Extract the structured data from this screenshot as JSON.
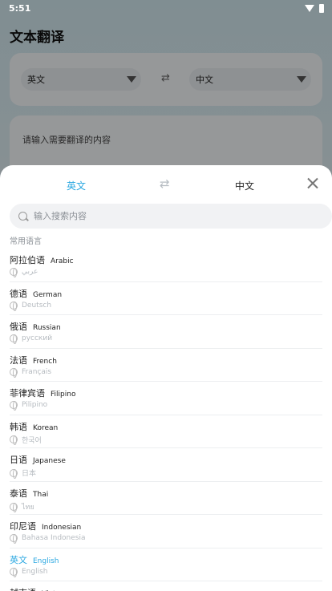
{
  "status_bar": {
    "time": "5:51"
  },
  "background_page": {
    "title": "文本翻译",
    "source_lang": "英文",
    "target_lang": "中文",
    "swap_glyph": "⇄",
    "input_placeholder": "请输入需要翻译的内容"
  },
  "sheet": {
    "source_tab": "英文",
    "swap_glyph": "⇄",
    "target_tab": "中文",
    "search_placeholder": "输入搜索内容",
    "section_label": "常用语言",
    "accent_color": "#29a7e1",
    "languages": [
      {
        "zh": "阿拉伯语",
        "en": "Arabic",
        "native": "عربي"
      },
      {
        "zh": "德语",
        "en": "German",
        "native": "Deutsch"
      },
      {
        "zh": "俄语",
        "en": "Russian",
        "native": "русский"
      },
      {
        "zh": "法语",
        "en": "French",
        "native": "Français"
      },
      {
        "zh": "菲律宾语",
        "en": "Filipino",
        "native": "Pilipino"
      },
      {
        "zh": "韩语",
        "en": "Korean",
        "native": "한국어"
      },
      {
        "zh": "日语",
        "en": "Japanese",
        "native": "日本"
      },
      {
        "zh": "泰语",
        "en": "Thai",
        "native": "ไทย"
      },
      {
        "zh": "印尼语",
        "en": "Indonesian",
        "native": "Bahasa Indonesia"
      },
      {
        "zh": "英文",
        "en": "English",
        "native": "English",
        "selected": true
      },
      {
        "zh": "越南语",
        "en": "Vietnamese",
        "native": ""
      }
    ]
  }
}
